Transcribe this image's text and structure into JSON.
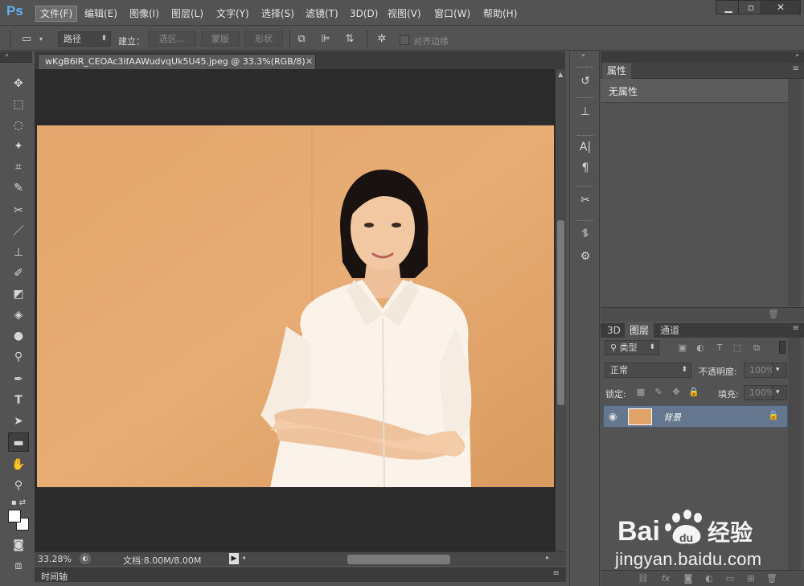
{
  "app": {
    "logo": "Ps",
    "menu": [
      "文件(F)",
      "编辑(E)",
      "图像(I)",
      "图层(L)",
      "文字(Y)",
      "选择(S)",
      "滤镜(T)",
      "3D(D)",
      "视图(V)",
      "窗口(W)",
      "帮助(H)"
    ],
    "window_controls": [
      "minimize-icon",
      "maximize-icon",
      "close-icon"
    ]
  },
  "options_bar": {
    "mode_value": "路径",
    "build_label": "建立：",
    "selection_button": "选区...",
    "mask_button": "蒙版",
    "shape_button": "形状",
    "align_edges_label": "对齐边缘"
  },
  "document": {
    "tab_title": "wKgB6lR_CEOAc3ifAAWudvqUk5U45.jpeg @ 33.3%(RGB/8)",
    "zoom": "33.28%",
    "doc_size": "文档:8.00M/8.00M",
    "canvas_bg": "#2b2b2b",
    "photo_bg": "#e0a46a"
  },
  "timeline": {
    "label": "时间轴"
  },
  "properties_panel": {
    "tab": "属性",
    "empty_text": "无属性"
  },
  "layers_panel": {
    "tabs": [
      "3D",
      "图层",
      "通道"
    ],
    "active_tab": "图层",
    "filter_label": "类型",
    "blend_mode": "正常",
    "opacity_label": "不透明度:",
    "opacity_value": "100%",
    "lock_label": "锁定:",
    "fill_label": "填充:",
    "fill_value": "100%",
    "layers": [
      {
        "name": "背景",
        "visible": true,
        "locked": true,
        "selected": true
      }
    ]
  },
  "watermark": {
    "url": "jingyan.baidu.com",
    "logo_text": "Bai",
    "logo_text2": "du",
    "logo_cn": "经验"
  },
  "colors": {
    "ui_bg": "#535353",
    "selected_layer": "#64778f",
    "logo_blue": "#5fb0f5"
  }
}
